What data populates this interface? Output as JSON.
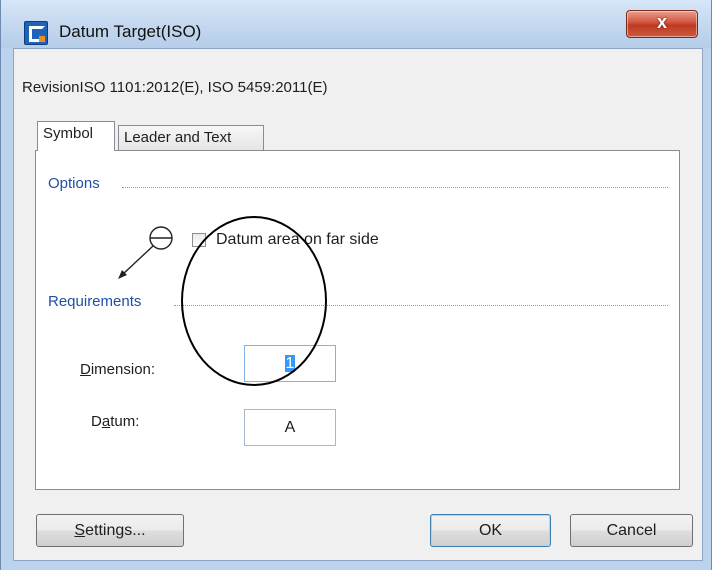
{
  "window": {
    "title": "Datum Target(ISO)",
    "close_label": "x"
  },
  "revision_text": "RevisionISO 1101:2012(E), ISO 5459:2011(E)",
  "tabs": [
    {
      "label": "Symbol",
      "selected": true
    },
    {
      "label": "Leader and Text",
      "selected": false
    }
  ],
  "options": {
    "group_label": "Options",
    "datum_far_side": {
      "label": "Datum area on far side",
      "checked": false
    }
  },
  "requirements": {
    "group_label": "Requirements",
    "dimension": {
      "label_pre": "",
      "label_underlined": "D",
      "label_post": "imension:",
      "value": "1"
    },
    "datum": {
      "label_pre": "D",
      "label_underlined": "a",
      "label_post": "tum:",
      "value": "A"
    }
  },
  "buttons": {
    "settings": {
      "underlined": "S",
      "rest": "ettings..."
    },
    "ok": "OK",
    "cancel": "Cancel"
  },
  "colors": {
    "group_label": "#1f4fa6",
    "selection": "#3399ff",
    "close_button": "#d2533b"
  },
  "icons": [
    "app-icon",
    "close-icon",
    "datum-target-symbol-icon",
    "checkbox"
  ]
}
